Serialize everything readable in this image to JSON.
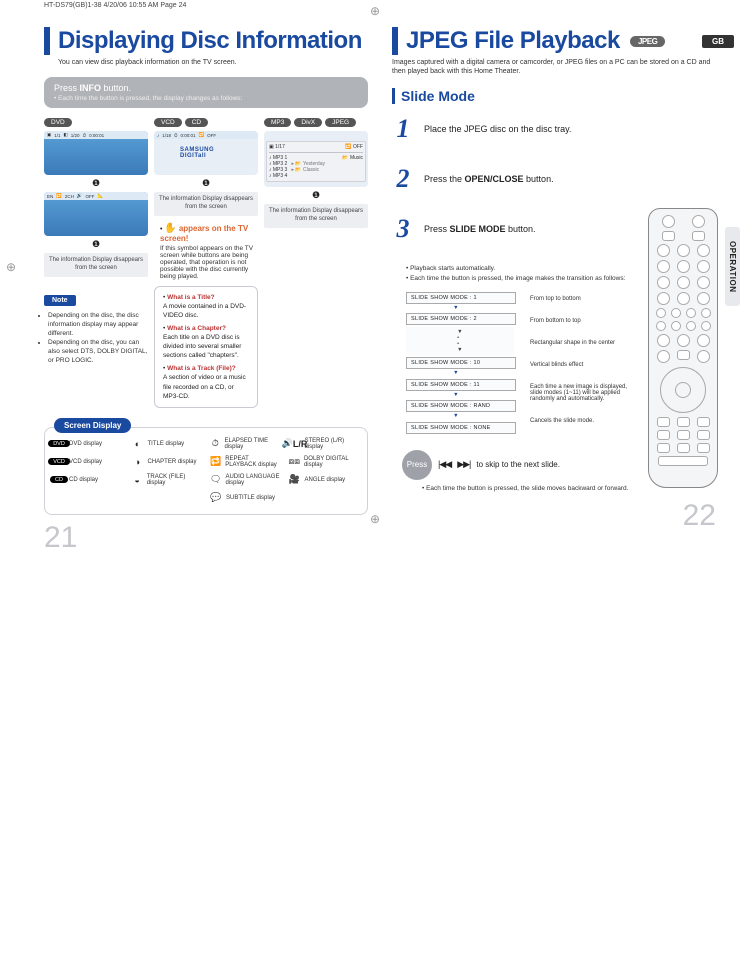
{
  "meta": {
    "print_header": "HT-DS79(GB)1-38  4/20/06 10:55 AM  Page 24"
  },
  "left": {
    "title": "Displaying Disc Information",
    "subtitle": "You can view disc playback information  on the TV screen.",
    "infobox_text": "Press INFO button.",
    "infobox_sub": "• Each time the button is pressed, the display changes as follows:",
    "formats": {
      "dvd": "DVD",
      "vcd": "VCD",
      "cd": "CD",
      "mp3": "MP3",
      "divx": "DivX",
      "jpeg": "JPEG"
    },
    "excl": "❶",
    "caption": "The information Display disappears from the screen",
    "samsung": "SAMSUNG DIGITall",
    "warn": {
      "title": "appears on the TV screen!",
      "body": "If this symbol appears on the TV screen while buttons are being operated, that operation is not possible with the disc currently being played."
    },
    "note_label": "Note",
    "notes": [
      "Depending on the disc, the disc information display may appear different.",
      "Depending on the disc, you can also select DTS, DOLBY DIGITAL, or PRO LOGIC."
    ],
    "faq": [
      {
        "q": "What is a Title?",
        "a": "A movie contained in a DVD-VIDEO disc."
      },
      {
        "q": "What is a Chapter?",
        "a": "Each title on a DVD disc is divided into several smaller sections called \"chapters\"."
      },
      {
        "q": "What is a Track (File)?",
        "a": "A section of video or a music file recorded on a CD, or MP3-CD."
      }
    ],
    "sd_label": "Screen Display",
    "icons": {
      "dvd_disp": "DVD display",
      "title": "TITLE display",
      "elapsed": "ELAPSED TIME display",
      "stereo": "STEREO (L/R) display",
      "vcd_disp": "VCD display",
      "chapter": "CHAPTER display",
      "repeat": "REPEAT PLAYBACK display",
      "dolby": "DOLBY DIGITAL display",
      "cd_disp": "CD display",
      "track": "TRACK (FILE) display",
      "audio": "AUDIO LANGUAGE display",
      "angle": "ANGLE display",
      "subtitle": "SUBTITLE display"
    },
    "dvd_pill": "DVD",
    "vcd_pill": "VCD",
    "cd_pill": "CD",
    "lr": "L/R",
    "page_num": "21"
  },
  "right": {
    "title": "JPEG File Playback",
    "title_badge": "JPEG",
    "subtitle": "Images captured with a digital camera or camcorder, or JPEG files on a PC can be stored on a CD and then played back with this Home Theater.",
    "gb": "GB",
    "op_tab": "OPERATION",
    "section": "Slide Mode",
    "steps": [
      {
        "n": "1",
        "t": "Place the JPEG disc on the disc tray."
      },
      {
        "n": "2",
        "t_pre": "Press the ",
        "t_bold": "OPEN/CLOSE",
        "t_post": " button."
      },
      {
        "n": "3",
        "t_pre": "Press ",
        "t_bold": "SLIDE MODE",
        "t_post": " button."
      }
    ],
    "pb": [
      "Playback starts automatically.",
      "Each time the button is pressed, the image makes the transition as follows:"
    ],
    "modes": {
      "m1": "SLIDE SHOW MODE : 1",
      "m2": "SLIDE SHOW MODE : 2",
      "m10": "SLIDE SHOW MODE : 10",
      "m11": "SLIDE SHOW MODE : 11",
      "mr": "SLIDE SHOW MODE : RAND",
      "mn": "SLIDE SHOW MODE : NONE"
    },
    "mode_desc": {
      "d1": "From top to bottom",
      "d2": "From bottom to top",
      "d10": "Rectangular shape in the center",
      "d11": "Vertical blinds effect",
      "dr": "Each time a new image is displayed, slide modes (1~11) will be applied randomly and automatically.",
      "dn": "Cancels the slide mode."
    },
    "press": "Press",
    "skip_text": "to skip to the next slide.",
    "skip_note": "• Each time the button is pressed, the slide moves backward or forward.",
    "page_num": "22"
  }
}
